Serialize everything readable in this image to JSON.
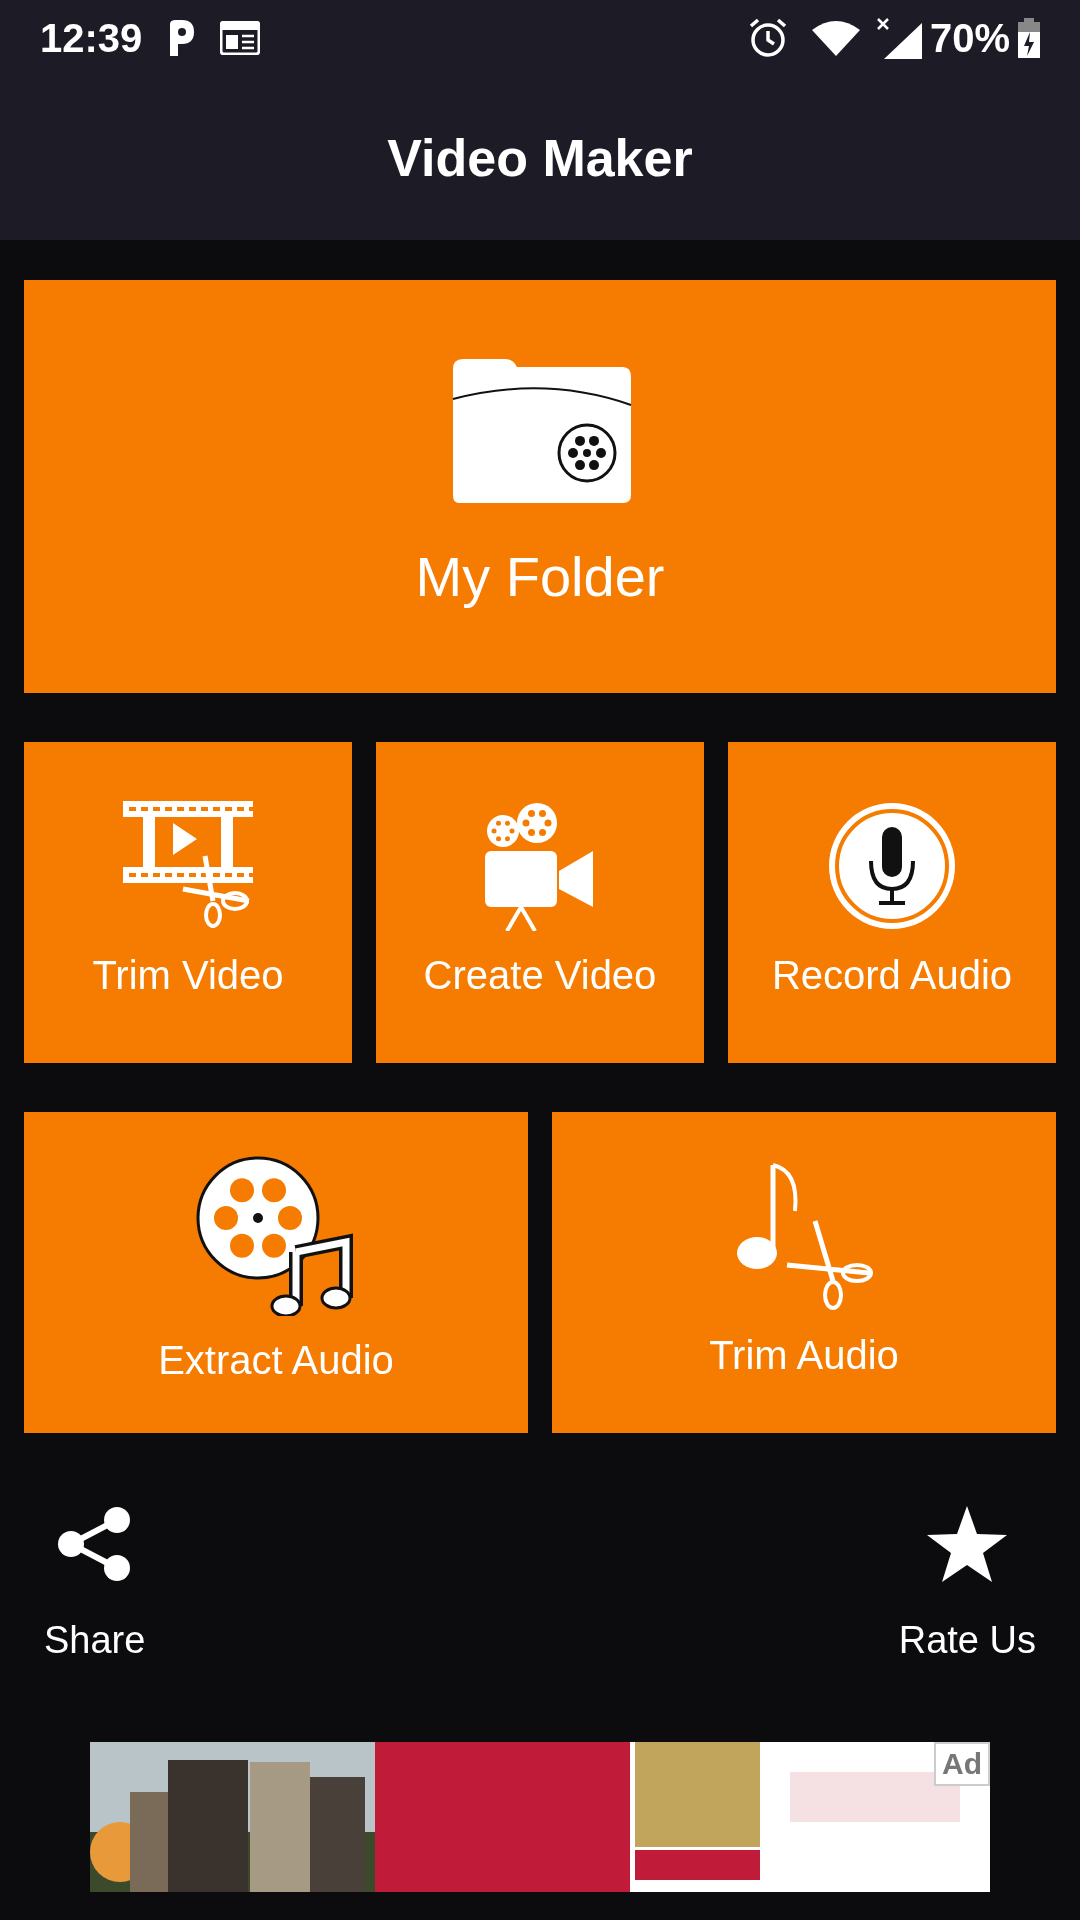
{
  "status_bar": {
    "time": "12:39",
    "battery": "70%"
  },
  "app_bar": {
    "title": "Video Maker"
  },
  "tile_rows": [
    [
      {
        "label": "My Folder",
        "kind": "folder"
      }
    ],
    [
      {
        "label": "Trim Video",
        "kind": "trim-video"
      },
      {
        "label": "Create Video",
        "kind": "camera"
      },
      {
        "label": "Record Audio",
        "kind": "mic"
      }
    ],
    [
      {
        "label": "Extract Audio",
        "kind": "reel-music"
      },
      {
        "label": "Trim Audio",
        "kind": "note-scissors"
      }
    ]
  ],
  "actions": [
    {
      "label": "Share",
      "kind": "share"
    },
    {
      "label": "Rate Us",
      "kind": "star"
    }
  ],
  "ad": {
    "kind": "picture",
    "badge": "Ad"
  }
}
